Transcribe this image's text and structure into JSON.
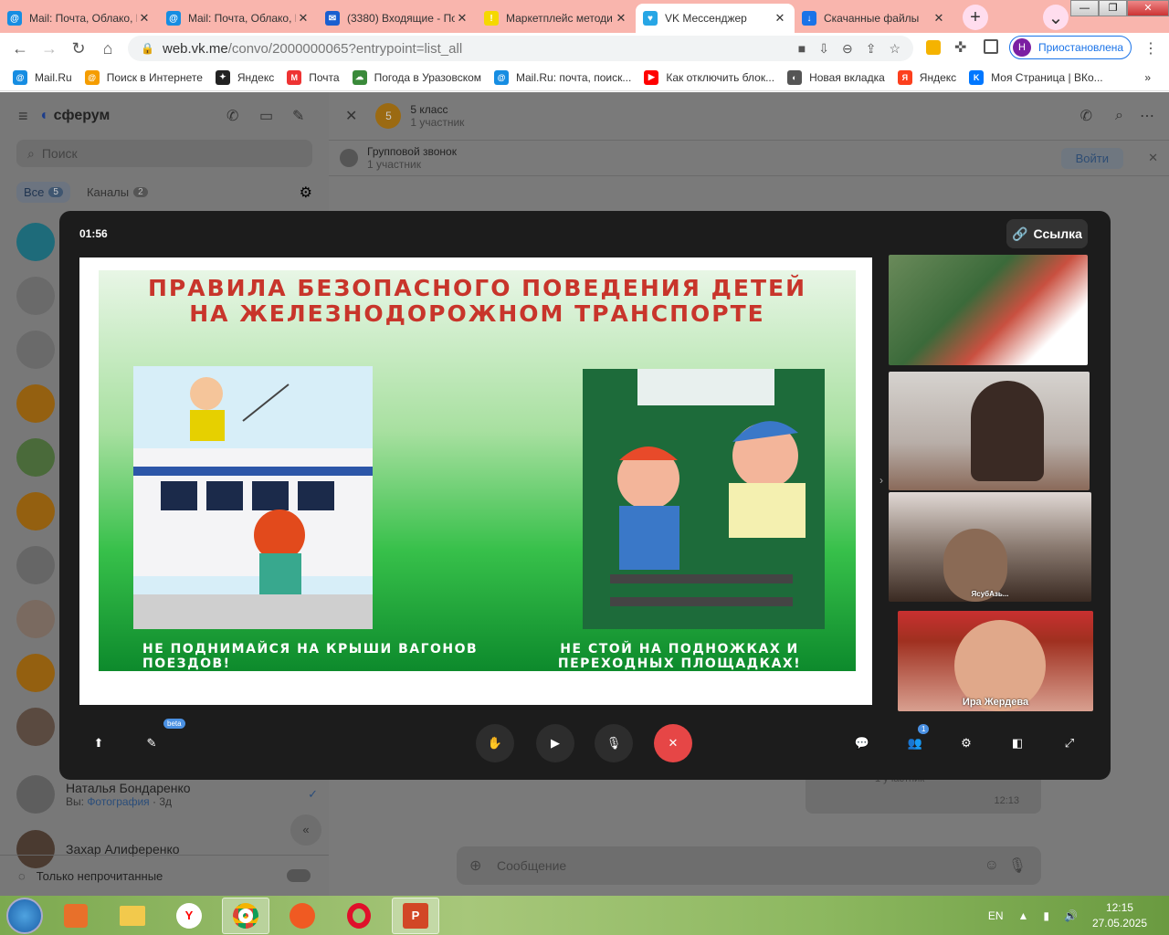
{
  "browser": {
    "tabs": [
      {
        "title": "Mail: Почта, Облако, К",
        "icon_color": "#168de2",
        "icon_glyph": "@"
      },
      {
        "title": "Mail: Почта, Облако, К",
        "icon_color": "#168de2",
        "icon_glyph": "@"
      },
      {
        "title": "(3380) Входящие - По",
        "icon_color": "#1a5fd0",
        "icon_glyph": "✉"
      },
      {
        "title": "Маркетплейс методи",
        "icon_color": "#f5d800",
        "icon_glyph": "!"
      },
      {
        "title": "VK Мессенджер",
        "icon_color": "#27a6e5",
        "icon_glyph": "♥",
        "active": true
      },
      {
        "title": "Скачанные файлы",
        "icon_color": "#1a73e8",
        "icon_glyph": "↓"
      }
    ],
    "url_host": "web.vk.me",
    "url_path": "/convo/2000000065?entrypoint=list_all",
    "profile_initial": "Н",
    "profile_label": "Приостановлена",
    "bookmarks": [
      {
        "label": "Mail.Ru",
        "color": "#168de2",
        "glyph": "@"
      },
      {
        "label": "Поиск в Интернете",
        "color": "#f59d00",
        "glyph": "@"
      },
      {
        "label": "Яндекс",
        "color": "#222",
        "glyph": "✦"
      },
      {
        "label": "Почта",
        "color": "#e33",
        "glyph": "M"
      },
      {
        "label": "Погода в Уразовском",
        "color": "#3a8a3a",
        "glyph": "☁"
      },
      {
        "label": "Mail.Ru: почта, поиск...",
        "color": "#168de2",
        "glyph": "@"
      },
      {
        "label": "Как отключить блок...",
        "color": "#f00",
        "glyph": "▶"
      },
      {
        "label": "Новая вкладка",
        "color": "#555",
        "glyph": "◐"
      },
      {
        "label": "Яндекс",
        "color": "#fc3f1d",
        "glyph": "Я"
      },
      {
        "label": "Моя Страница | ВКо...",
        "color": "#0077ff",
        "glyph": "K"
      }
    ]
  },
  "sidebar": {
    "brand": "сферум",
    "search_placeholder": "Поиск",
    "filter_all": "Все",
    "filter_all_count": "5",
    "filter_channels": "Каналы",
    "filter_channels_count": "2",
    "contacts": [
      {
        "name": "Наталья Бондаренко",
        "preview_prefix": "Вы:",
        "preview": "Фотография",
        "time": "· 3д"
      },
      {
        "name": "Захар Алиференко"
      }
    ],
    "unread_only": "Только непрочитанные"
  },
  "chat": {
    "avatar_letter": "5",
    "title": "5 класс",
    "subtitle": "1 участник",
    "call_title": "Групповой звонок",
    "call_subtitle": "1 участник",
    "join_label": "Войти",
    "message_placeholder": "Сообщение",
    "bg_time": "12:13",
    "bg_participants": "1 участник"
  },
  "call": {
    "timer": "01:56",
    "link_label": "Ссылка",
    "slide_title": "ПРАВИЛА БЕЗОПАСНОГО ПОВЕДЕНИЯ ДЕТЕЙ НА ЖЕЛЕЗНОДОРОЖНОМ ТРАНСПОРТЕ",
    "caption_left": "НЕ ПОДНИМАЙСЯ НА КРЫШИ ВАГОНОВ ПОЕЗДОВ!",
    "caption_right": "НЕ СТОЙ НА ПОДНОЖКАХ И ПЕРЕХОДНЫХ ПЛОЩАДКАХ!",
    "participants": [
      {
        "name": ""
      },
      {
        "name": ""
      },
      {
        "name": "ЯсубАзь..."
      },
      {
        "name": "Ира Жердева"
      }
    ],
    "beta_label": "beta",
    "participants_badge": "1"
  },
  "taskbar": {
    "lang": "EN",
    "time": "12:15",
    "date": "27.05.2025"
  }
}
